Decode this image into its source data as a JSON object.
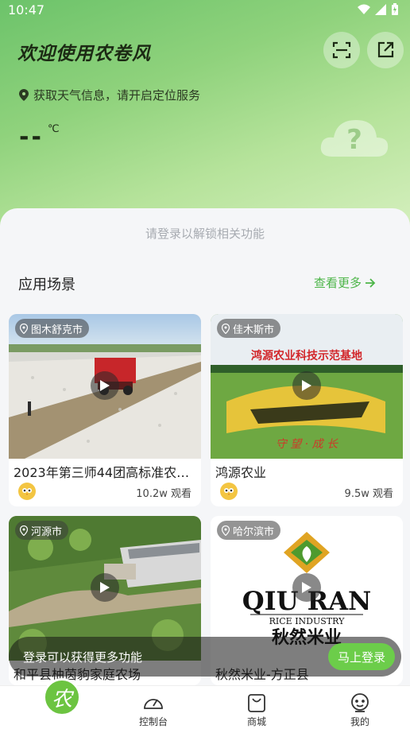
{
  "status": {
    "time": "10:47"
  },
  "header": {
    "welcome": "欢迎使用农卷风",
    "location_text": "获取天气信息，请开启定位服务",
    "temperature": "--",
    "temperature_unit": "℃"
  },
  "panel": {
    "login_hint": "请登录以解锁相关功能",
    "section_title": "应用场景",
    "more_label": "查看更多"
  },
  "cards": [
    {
      "location": "图木舒克市",
      "title": "2023年第三师44团高标准农…",
      "views": "10.2w 观看"
    },
    {
      "location": "佳木斯市",
      "title": "鸿源农业",
      "views": "9.5w 观看",
      "image_text": "鸿源农业科技示范基地"
    },
    {
      "location": "河源市",
      "title": "和平县柚茵豿家庭农场",
      "views": ""
    },
    {
      "location": "哈尔滨市",
      "title": "秋然米业-方正县",
      "views": "",
      "logo_main": "QIU RAN",
      "logo_sub": "RICE INDUSTRY",
      "logo_cn": "秋然米业"
    }
  ],
  "login_banner": {
    "text": "登录可以获得更多功能",
    "button": "马上登录"
  },
  "tabbar": {
    "home_glyph": "农",
    "items": [
      {
        "label": "控制台"
      },
      {
        "label": "商城"
      },
      {
        "label": "我的"
      }
    ]
  },
  "colors": {
    "accent": "#4cb548",
    "button_green": "#6ccd4a"
  }
}
